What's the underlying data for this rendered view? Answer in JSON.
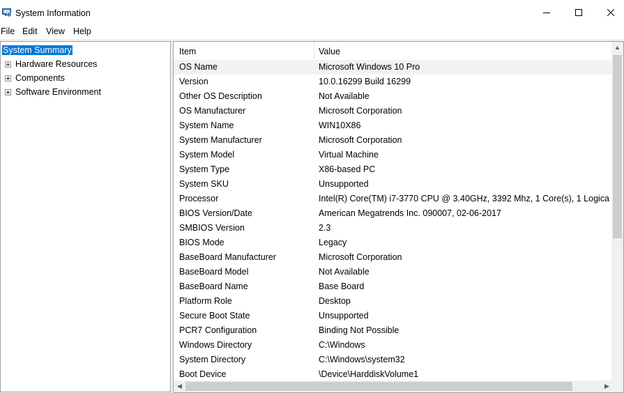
{
  "window": {
    "title": "System Information",
    "controls": [
      "minimize",
      "maximize",
      "close"
    ]
  },
  "menu": [
    "File",
    "Edit",
    "View",
    "Help"
  ],
  "tree": [
    {
      "label": "System Summary",
      "selected": true,
      "expandable": false
    },
    {
      "label": "Hardware Resources",
      "selected": false,
      "expandable": true
    },
    {
      "label": "Components",
      "selected": false,
      "expandable": true
    },
    {
      "label": "Software Environment",
      "selected": false,
      "expandable": true
    }
  ],
  "table": {
    "columns": [
      "Item",
      "Value"
    ],
    "rows": [
      [
        "OS Name",
        "Microsoft Windows 10 Pro"
      ],
      [
        "Version",
        "10.0.16299 Build 16299"
      ],
      [
        "Other OS Description",
        "Not Available"
      ],
      [
        "OS Manufacturer",
        "Microsoft Corporation"
      ],
      [
        "System Name",
        "WIN10X86"
      ],
      [
        "System Manufacturer",
        "Microsoft Corporation"
      ],
      [
        "System Model",
        "Virtual Machine"
      ],
      [
        "System Type",
        "X86-based PC"
      ],
      [
        "System SKU",
        "Unsupported"
      ],
      [
        "Processor",
        "Intel(R) Core(TM) i7-3770 CPU @ 3.40GHz, 3392 Mhz, 1 Core(s), 1 Logica"
      ],
      [
        "BIOS Version/Date",
        "American Megatrends Inc. 090007, 02-06-2017"
      ],
      [
        "SMBIOS Version",
        "2.3"
      ],
      [
        "BIOS Mode",
        "Legacy"
      ],
      [
        "BaseBoard Manufacturer",
        "Microsoft Corporation"
      ],
      [
        "BaseBoard Model",
        "Not Available"
      ],
      [
        "BaseBoard Name",
        "Base Board"
      ],
      [
        "Platform Role",
        "Desktop"
      ],
      [
        "Secure Boot State",
        "Unsupported"
      ],
      [
        "PCR7 Configuration",
        "Binding Not Possible"
      ],
      [
        "Windows Directory",
        "C:\\Windows"
      ],
      [
        "System Directory",
        "C:\\Windows\\system32"
      ],
      [
        "Boot Device",
        "\\Device\\HarddiskVolume1"
      ]
    ]
  },
  "colors": {
    "selection": "#0078d7",
    "border": "#a0a0a0"
  }
}
